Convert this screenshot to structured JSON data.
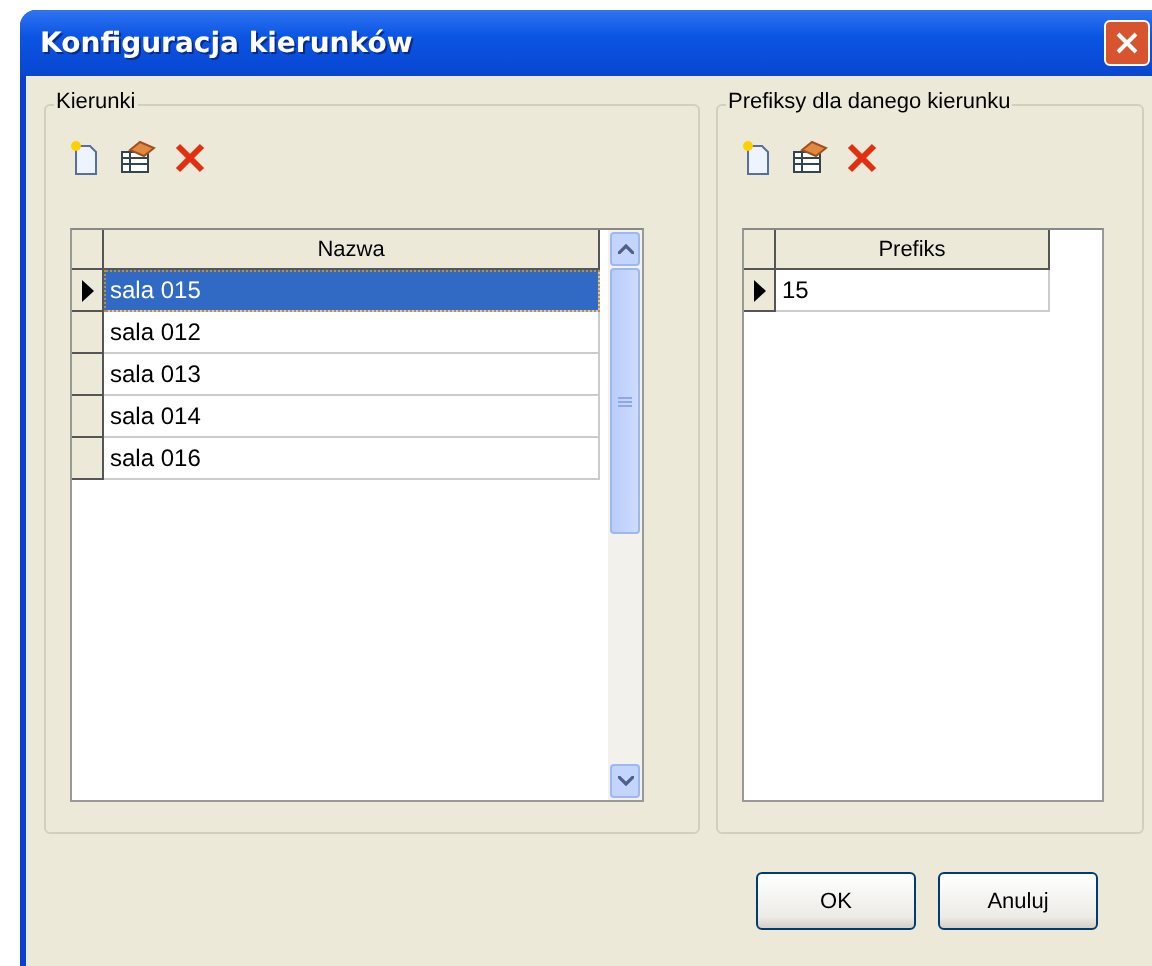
{
  "window": {
    "title": "Konfiguracja kierunków"
  },
  "groups": [
    {
      "title": "Kierunki",
      "scrollbar": true,
      "table": {
        "columns": [
          "Nazwa"
        ],
        "rows": [
          {
            "cells": [
              "sala 015"
            ],
            "current": true,
            "selected": true
          },
          {
            "cells": [
              "sala 012"
            ],
            "current": false,
            "selected": false
          },
          {
            "cells": [
              "sala 013"
            ],
            "current": false,
            "selected": false
          },
          {
            "cells": [
              "sala 014"
            ],
            "current": false,
            "selected": false
          },
          {
            "cells": [
              "sala 016"
            ],
            "current": false,
            "selected": false
          }
        ]
      }
    },
    {
      "title": "Prefiksy dla danego kierunku",
      "scrollbar": false,
      "table": {
        "columns": [
          "Prefiks"
        ],
        "rows": [
          {
            "cells": [
              "15"
            ],
            "current": true,
            "selected": false
          }
        ]
      }
    }
  ],
  "buttons": [
    "OK",
    "Anuluj"
  ]
}
